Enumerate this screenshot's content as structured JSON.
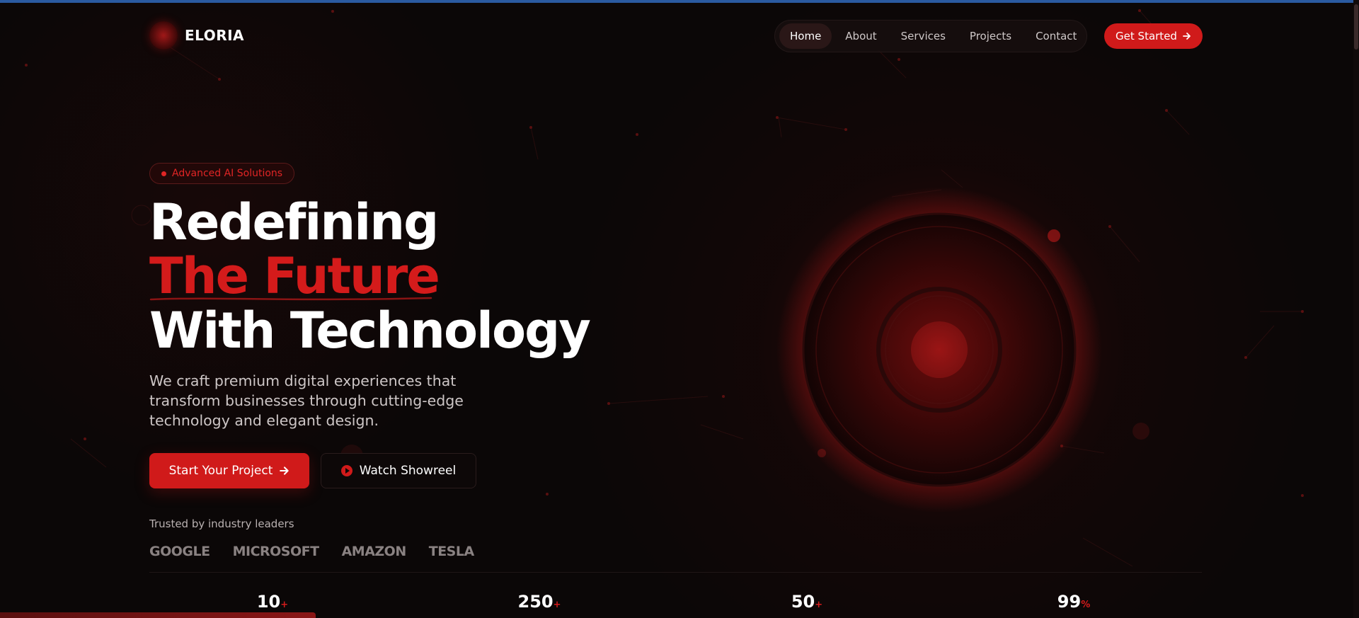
{
  "brand": {
    "name": "ELORIA",
    "accent": "#d01a1a"
  },
  "nav": {
    "items": [
      {
        "label": "Home",
        "active": true
      },
      {
        "label": "About",
        "active": false
      },
      {
        "label": "Services",
        "active": false
      },
      {
        "label": "Projects",
        "active": false
      },
      {
        "label": "Contact",
        "active": false
      }
    ],
    "cta": "Get Started"
  },
  "hero": {
    "badge": "Advanced AI Solutions",
    "title_line1": "Redefining",
    "title_line2": "The Future",
    "title_line3": "With Technology",
    "description": "We craft premium digital experiences that transform businesses through cutting-edge technology and elegant design.",
    "primary_button": "Start Your Project",
    "secondary_button": "Watch Showreel",
    "trusted_label": "Trusted by industry leaders",
    "brands": [
      "GOOGLE",
      "MICROSOFT",
      "AMAZON",
      "TESLA"
    ]
  },
  "stats": [
    {
      "value": "10",
      "suffix": "+"
    },
    {
      "value": "250",
      "suffix": "+"
    },
    {
      "value": "50",
      "suffix": "+"
    },
    {
      "value": "99",
      "suffix": "%"
    }
  ],
  "icons": {
    "cta_arrow": "arrow-right-icon",
    "play": "play-icon",
    "badge_dot": "dot-icon"
  }
}
